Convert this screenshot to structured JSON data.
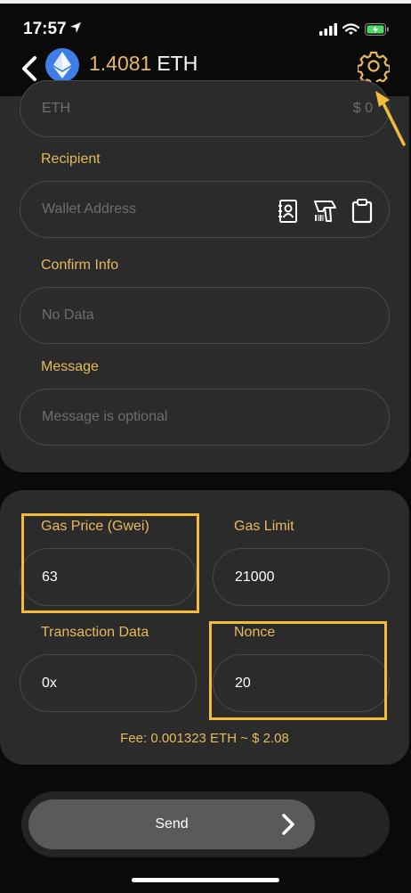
{
  "status": {
    "time": "17:57"
  },
  "header": {
    "balance_amount": "1.4081",
    "currency": "ETH"
  },
  "amount_field": {
    "currency_placeholder": "ETH",
    "usd_placeholder": "$ 0"
  },
  "recipient": {
    "label": "Recipient",
    "placeholder": "Wallet Address"
  },
  "confirm": {
    "label": "Confirm Info",
    "placeholder": "No Data"
  },
  "message": {
    "label": "Message",
    "placeholder": "Message is optional"
  },
  "gas": {
    "price_label": "Gas Price (Gwei)",
    "price_value": "63",
    "limit_label": "Gas Limit",
    "limit_value": "21000",
    "data_label": "Transaction Data",
    "data_value": "0x",
    "nonce_label": "Nonce",
    "nonce_value": "20",
    "fee_text": "Fee: 0.001323 ETH ~ $ 2.08"
  },
  "send": {
    "label": "Send"
  },
  "colors": {
    "accent": "#e7b95a",
    "highlight": "#f2bd3b",
    "card": "#2b2b2b",
    "background": "#0a0a0a",
    "eth_blue": "#3f7ee8"
  }
}
